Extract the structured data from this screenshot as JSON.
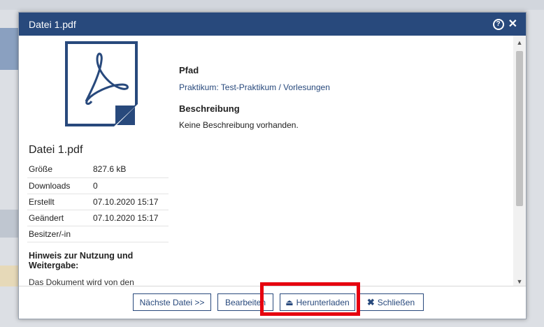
{
  "dialog": {
    "title": "Datei 1.pdf",
    "help_icon": "help-circle-icon",
    "close_icon": "close-icon"
  },
  "file": {
    "icon": "pdf-document-icon",
    "name": "Datei 1.pdf",
    "meta": [
      {
        "key": "Größe",
        "value": "827.6 kB"
      },
      {
        "key": "Downloads",
        "value": "0"
      },
      {
        "key": "Erstellt",
        "value": "07.10.2020 15:17"
      },
      {
        "key": "Geändert",
        "value": "07.10.2020 15:17"
      },
      {
        "key": "Besitzer/-in",
        "value": ""
      }
    ],
    "hint_title": "Hinweis zur Nutzung und Weitergabe:",
    "hint_text": "Das Dokument wird von den"
  },
  "details": {
    "path_label": "Pfad",
    "path_value": "Praktikum: Test-Praktikum / Vorlesungen",
    "description_label": "Beschreibung",
    "description_value": "Keine Beschreibung vorhanden."
  },
  "footer": {
    "next_label": "Nächste Datei >>",
    "edit_label": "Bearbeiten",
    "download_label": "Herunterladen",
    "download_icon": "download-icon",
    "close_label": "Schließen",
    "close_icon": "close-icon"
  },
  "colors": {
    "titlebar": "#28497c",
    "highlight": "#e6000f"
  }
}
